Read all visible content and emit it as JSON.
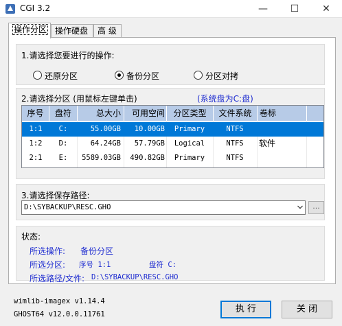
{
  "window": {
    "title": "CGI 3.2",
    "minimize": "—",
    "maximize": "☐",
    "close": "✕"
  },
  "tabs": [
    {
      "label": "操作分区"
    },
    {
      "label": "操作硬盘"
    },
    {
      "label": "高 级"
    }
  ],
  "section1": {
    "label": "1.请选择您要进行的操作:",
    "options": [
      {
        "label": "还原分区",
        "checked": false
      },
      {
        "label": "备份分区",
        "checked": true
      },
      {
        "label": "分区对拷",
        "checked": false
      }
    ]
  },
  "section2": {
    "label": "2.请选择分区 (用鼠标左键单击)",
    "system_note": "(系统盘为C:盘)",
    "columns": [
      "序号",
      "盘符",
      "总大小",
      "可用空间",
      "分区类型",
      "文件系统",
      "卷标"
    ],
    "rows": [
      {
        "no": "1:1",
        "drive": "C:",
        "total": "55.00GB",
        "free": "10.00GB",
        "type": "Primary",
        "fs": "NTFS",
        "label": "",
        "selected": true
      },
      {
        "no": "1:2",
        "drive": "D:",
        "total": "64.24GB",
        "free": "57.79GB",
        "type": "Logical",
        "fs": "NTFS",
        "label": "软件",
        "selected": false
      },
      {
        "no": "2:1",
        "drive": "E:",
        "total": "5589.03GB",
        "free": "490.82GB",
        "type": "Primary",
        "fs": "NTFS",
        "label": "",
        "selected": false
      }
    ]
  },
  "section3": {
    "label": "3.请选择保存路径:",
    "path_value": "D:\\SYBACKUP\\RESC.GHO",
    "browse_label": "..."
  },
  "status": {
    "title": "状态:",
    "op_label": "所选操作:",
    "op_value": "备份分区",
    "part_label": "所选分区:",
    "part_no": "序号 1:1",
    "part_drive": "盘符 C:",
    "path_label": "所选路径/文件:",
    "path_value": "D:\\SYBACKUP\\RESC.GHO"
  },
  "footer": {
    "wimlib": "wimlib-imagex v1.14.4",
    "ghost": "GHOST64 v12.0.0.11761",
    "execute_label": "执 行",
    "close_label": "关 闭"
  },
  "colors": {
    "selection": "#0078d7",
    "header": "#b7cbe7",
    "status_text": "#1d2bd0"
  }
}
